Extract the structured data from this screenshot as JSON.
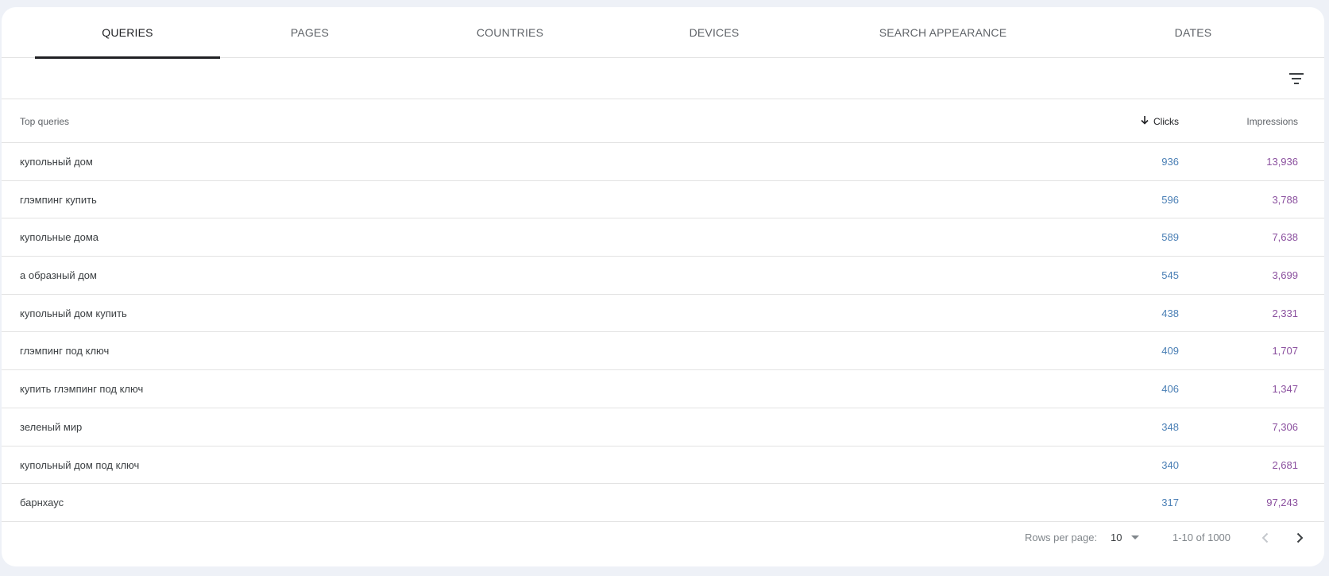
{
  "tabs": [
    {
      "label": "QUERIES",
      "active": true
    },
    {
      "label": "PAGES",
      "active": false
    },
    {
      "label": "COUNTRIES",
      "active": false
    },
    {
      "label": "DEVICES",
      "active": false
    },
    {
      "label": "SEARCH APPEARANCE",
      "active": false
    },
    {
      "label": "DATES",
      "active": false
    }
  ],
  "filter_icon": "filter-list-icon",
  "table": {
    "headers": {
      "query": "Top queries",
      "clicks": "Clicks",
      "impressions": "Impressions",
      "sort_icon": "arrow-down-icon"
    },
    "rows": [
      {
        "query": "купольный дом",
        "clicks": "936",
        "impressions": "13,936"
      },
      {
        "query": "глэмпинг купить",
        "clicks": "596",
        "impressions": "3,788"
      },
      {
        "query": "купольные дома",
        "clicks": "589",
        "impressions": "7,638"
      },
      {
        "query": "а образный дом",
        "clicks": "545",
        "impressions": "3,699"
      },
      {
        "query": "купольный дом купить",
        "clicks": "438",
        "impressions": "2,331"
      },
      {
        "query": "глэмпинг под ключ",
        "clicks": "409",
        "impressions": "1,707"
      },
      {
        "query": "купить глэмпинг под ключ",
        "clicks": "406",
        "impressions": "1,347"
      },
      {
        "query": "зеленый мир",
        "clicks": "348",
        "impressions": "7,306"
      },
      {
        "query": "купольный дом под ключ",
        "clicks": "340",
        "impressions": "2,681"
      },
      {
        "query": "барнхаус",
        "clicks": "317",
        "impressions": "97,243"
      }
    ]
  },
  "pagination": {
    "rows_per_page_label": "Rows per page:",
    "rows_per_page_value": "10",
    "range": "1-10 of 1000"
  },
  "colors": {
    "clicks": "#4a7fb5",
    "impressions": "#8a4f9e",
    "active_tab_underline": "#202124"
  }
}
